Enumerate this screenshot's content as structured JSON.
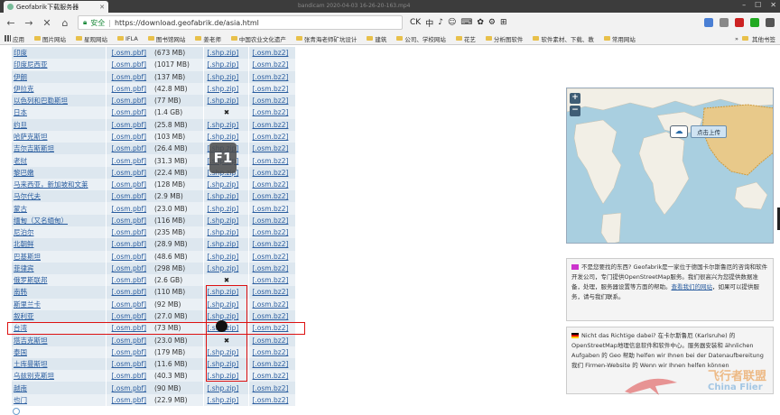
{
  "browser": {
    "tab_title": "Geofabrik下载服务器",
    "strip_watermark": "bandicam 2020-04-03 16-26-20-163.mp4",
    "url_secure_label": "安全",
    "url": "https://download.geofabrik.de/asia.html",
    "ime": [
      "CK",
      "中",
      "♪",
      "☺",
      "⌨",
      "✿",
      "⚙",
      "⊞"
    ],
    "bookmarks": [
      "应用",
      "图片网站",
      "星观网站",
      "IFLA",
      "图书馆网站",
      "姜老师",
      "中国农业文化遗产",
      "张青海老师矿坑设计",
      "建筑",
      "公司、学校网站",
      "花艺",
      "分析图软件",
      "软件素材、下载、教",
      "常用网站"
    ],
    "bookmarks_more": "»",
    "bookmarks_other": "其他书签"
  },
  "table": {
    "osm_label": "[.osm.pbf]",
    "shp_label": "[.shp.zip]",
    "bz2_label": "[.osm.bz2]",
    "no_shp": "✖",
    "rows": [
      {
        "name": "印度",
        "size": "(673 MB)",
        "shp": true
      },
      {
        "name": "印度尼西亚",
        "size": "(1017 MB)",
        "shp": true
      },
      {
        "name": "伊朗",
        "size": "(137 MB)",
        "shp": true
      },
      {
        "name": "伊拉克",
        "size": "(42.8 MB)",
        "shp": true
      },
      {
        "name": "以色列和巴勒斯坦",
        "size": "(77 MB)",
        "shp": true
      },
      {
        "name": "日本",
        "size": "(1.4 GB)",
        "shp": false
      },
      {
        "name": "约旦",
        "size": "(25.8 MB)",
        "shp": true
      },
      {
        "name": "哈萨克斯坦",
        "size": "(103 MB)",
        "shp": true
      },
      {
        "name": "吉尔吉斯斯坦",
        "size": "(26.4 MB)",
        "shp": true
      },
      {
        "name": "老挝",
        "size": "(31.3 MB)",
        "shp": true
      },
      {
        "name": "黎巴嫩",
        "size": "(22.4 MB)",
        "shp": true
      },
      {
        "name": "马来西亚，新加坡和文莱",
        "size": "(128 MB)",
        "shp": true
      },
      {
        "name": "马尔代夫",
        "size": "(2.9 MB)",
        "shp": true
      },
      {
        "name": "蒙古",
        "size": "(23.0 MB)",
        "shp": true
      },
      {
        "name": "缅甸（又名缅甸）",
        "size": "(116 MB)",
        "shp": true
      },
      {
        "name": "尼泊尔",
        "size": "(235 MB)",
        "shp": true
      },
      {
        "name": "北朝鲜",
        "size": "(28.9 MB)",
        "shp": true
      },
      {
        "name": "巴基斯坦",
        "size": "(48.6 MB)",
        "shp": true
      },
      {
        "name": "菲律宾",
        "size": "(298 MB)",
        "shp": true
      },
      {
        "name": "俄罗斯联邦",
        "size": "(2.6 GB)",
        "shp": false
      },
      {
        "name": "南韩",
        "size": "(110 MB)",
        "shp": true
      },
      {
        "name": "斯里兰卡",
        "size": "(92 MB)",
        "shp": true
      },
      {
        "name": "叙利亚",
        "size": "(27.0 MB)",
        "shp": true
      },
      {
        "name": "台湾",
        "size": "(73 MB)",
        "shp": true
      },
      {
        "name": "塔吉克斯坦",
        "size": "(23.0 MB)",
        "shp": false
      },
      {
        "name": "泰国",
        "size": "(179 MB)",
        "shp": true
      },
      {
        "name": "土库曼斯坦",
        "size": "(11.6 MB)",
        "shp": true
      },
      {
        "name": "乌兹别克斯坦",
        "size": "(40.3 MB)",
        "shp": true
      },
      {
        "name": "越南",
        "size": "(90 MB)",
        "shp": true
      },
      {
        "name": "也门",
        "size": "(22.9 MB)",
        "shp": true
      }
    ]
  },
  "overlay": {
    "f1_key": "F1"
  },
  "map": {
    "zoom_in": "+",
    "zoom_out": "−",
    "upload_label": "点击上传",
    "colors": {
      "water": "#a9cfe0",
      "land": "#f2efe6",
      "region": "#e8c98a",
      "border": "#d09a3a"
    }
  },
  "info_cn": {
    "text1": "不是您要找的东西? Geofabrik是一家位于德国卡尔斯鲁厄的咨询和软件开发公司，专门提供OpenStreetMap服务。我们很高兴为您提供数据准备，处理，服务器设置等方面的帮助。",
    "link1": "查看我们的网站",
    "text2": "，如果可以提供服务，请与我们联系。"
  },
  "info_de": {
    "text": "Nicht das Richtige dabei? 在卡尔斯鲁厄 (Karlsruhe) 的 OpenStreetMap地理信息软件和软件中心。服务器安装和 ähnlichen Aufgaben 的 Geo 帮助 helfen wir Ihnen bei der Datenaufbereitung 我们 Firmen-Website 的 Wenn wir Ihnen helfen können"
  },
  "watermark": {
    "line1": "飞行者联盟",
    "line2": "China Flier"
  }
}
